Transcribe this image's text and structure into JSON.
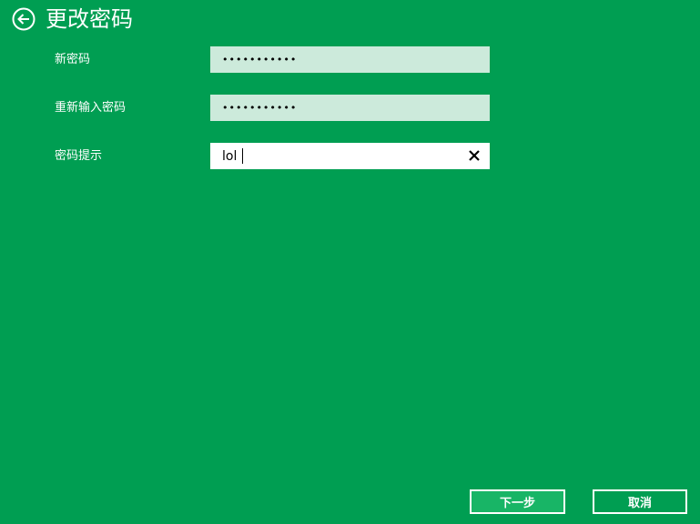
{
  "header": {
    "back_icon": "back-arrow-circle-icon",
    "title": "更改密码"
  },
  "form": {
    "new_password": {
      "label": "新密码",
      "value": "•••••••••••"
    },
    "confirm_password": {
      "label": "重新输入密码",
      "value": "•••••••••••"
    },
    "password_hint": {
      "label": "密码提示",
      "value": "lol",
      "clear_icon": "close-icon"
    }
  },
  "buttons": {
    "next_label": "下一步",
    "cancel_label": "取消"
  },
  "colors": {
    "background": "#009e52",
    "password_field": "#cceadb",
    "next_button": "#18b566"
  }
}
